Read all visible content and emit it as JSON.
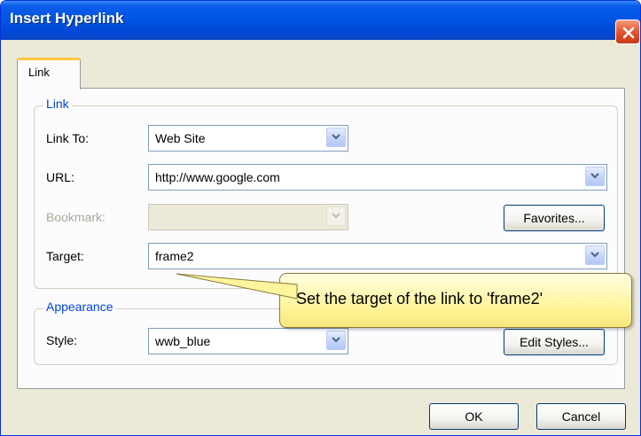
{
  "window": {
    "title": "Insert Hyperlink"
  },
  "tabs": [
    {
      "label": "Link",
      "selected": true
    }
  ],
  "link_group": {
    "legend": "Link",
    "link_to": {
      "label": "Link To:",
      "value": "Web Site"
    },
    "url": {
      "label": "URL:",
      "value": "http://www.google.com"
    },
    "bookmark": {
      "label": "Bookmark:",
      "value": "",
      "enabled": false
    },
    "favorites_button": "Favorites...",
    "target": {
      "label": "Target:",
      "value": "frame2"
    }
  },
  "appearance_group": {
    "legend": "Appearance",
    "style": {
      "label": "Style:",
      "value": "wwb_blue"
    },
    "edit_styles_button": "Edit Styles..."
  },
  "footer": {
    "ok_button": "OK",
    "cancel_button": "Cancel"
  },
  "callout": {
    "text": "Set the target of the link to 'frame2'"
  },
  "colors": {
    "titlebar": "#0054e3",
    "dialog_background": "#ece9d8",
    "group_legend": "#0046d5",
    "tab_highlight": "#ffc83c",
    "callout_fill": "#fff59e",
    "close_button": "#e2502a"
  },
  "icons": {
    "close": "close-icon",
    "dropdown": "chevron-down-icon"
  }
}
